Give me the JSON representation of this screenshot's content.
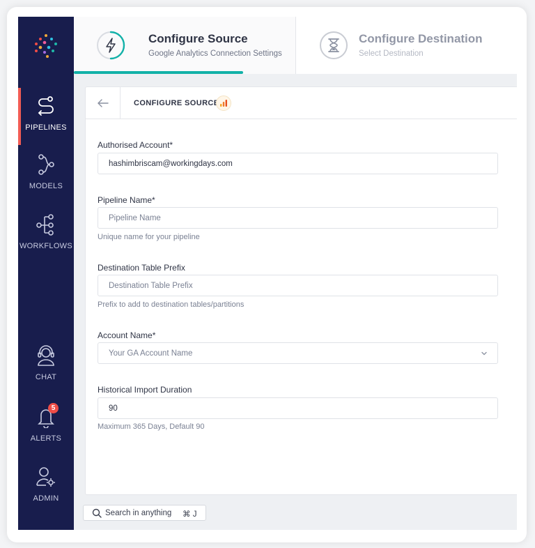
{
  "sidebar": {
    "items": [
      {
        "label": "PIPELINES",
        "icon": "pipelines-icon",
        "active": true
      },
      {
        "label": "MODELS",
        "icon": "models-icon",
        "active": false
      },
      {
        "label": "WORKFLOWS",
        "icon": "workflows-icon",
        "active": false
      },
      {
        "label": "CHAT",
        "icon": "chat-support-icon",
        "active": false
      },
      {
        "label": "ALERTS",
        "icon": "bell-icon",
        "active": false,
        "badge": "5"
      },
      {
        "label": "ADMIN",
        "icon": "admin-user-gear-icon",
        "active": false
      }
    ]
  },
  "steps": [
    {
      "title": "Configure Source",
      "subtitle": "Google Analytics Connection Settings",
      "icon": "lightning-bolt-icon",
      "active": true
    },
    {
      "title": "Configure Destination",
      "subtitle": "Select Destination",
      "icon": "hourglass-icon",
      "active": false
    }
  ],
  "card": {
    "title": "CONFIGURE SOURCE",
    "source_icon": "google-analytics-icon"
  },
  "form": {
    "authorised_account": {
      "label": "Authorised Account*",
      "value": "hashimbriscam@workingdays.com"
    },
    "pipeline_name": {
      "label": "Pipeline Name*",
      "placeholder": "Pipeline Name",
      "hint": "Unique name for your pipeline"
    },
    "destination_prefix": {
      "label": "Destination Table Prefix",
      "placeholder": "Destination Table Prefix",
      "hint": "Prefix to add to destination tables/partitions"
    },
    "account_name": {
      "label": "Account Name*",
      "placeholder": "Your GA Account Name"
    },
    "historical_duration": {
      "label": "Historical Import Duration",
      "value": "90",
      "hint": "Maximum 365 Days, Default 90"
    }
  },
  "search": {
    "placeholder": "Search in anything",
    "shortcut": "⌘ J"
  },
  "colors": {
    "sidebar": "#181d4d",
    "accent": "#12b1a8",
    "active_marker": "#f25c54",
    "badge": "#ef4c46"
  }
}
